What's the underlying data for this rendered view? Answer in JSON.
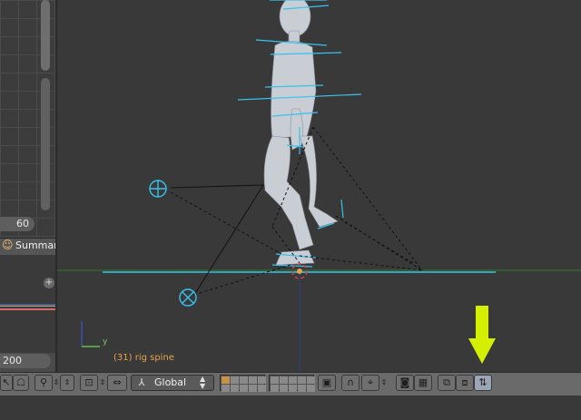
{
  "left_panel": {
    "frame_value": "60",
    "summary_label": "Summar",
    "summary_icon": "summary-icon",
    "add_icon": "plus-icon",
    "end_value": "200"
  },
  "viewport": {
    "object_label": "(31) rig spine",
    "axis_y_label": "y",
    "annotation_arrow_color": "#d4f000",
    "bone_color": "#39c2f0",
    "ground_line_color": "#39c2f0"
  },
  "header": {
    "orientation_value": "Global",
    "icons": {
      "select": "cursor-icon",
      "ghost": "ghost-icon",
      "zoom": "magnifier-icon",
      "pivot": "pivot-icon",
      "transform_manipulator": "manipulator-icon",
      "orientation": "axes-icon",
      "layers_1": "layer-grid-icon",
      "layers_2": "layer-grid-icon",
      "lock": "lock-icon",
      "proportional": "magnet-icon",
      "snap": "snap-icon",
      "render": "camera-icon",
      "clapper": "clapper-icon",
      "copy_pose": "copy-pose-icon",
      "paste_pose": "paste-pose-icon",
      "paste_flipped": "paste-flipped-icon"
    }
  }
}
